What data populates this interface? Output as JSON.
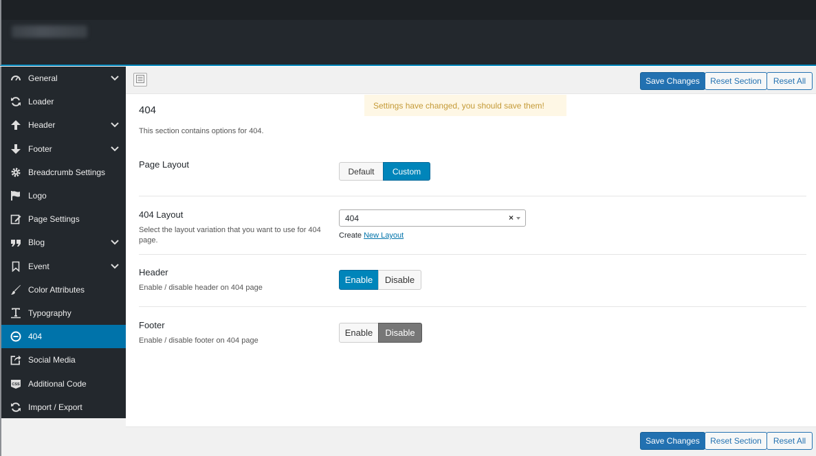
{
  "sidebar": {
    "items": [
      {
        "label": "General",
        "icon": "dashboard-gauge-icon",
        "expandable": true
      },
      {
        "label": "Loader",
        "icon": "refresh-icon",
        "expandable": false
      },
      {
        "label": "Header",
        "icon": "arrow-up-icon",
        "expandable": true
      },
      {
        "label": "Footer",
        "icon": "arrow-down-icon",
        "expandable": true
      },
      {
        "label": "Breadcrumb Settings",
        "icon": "gear-icon",
        "expandable": false
      },
      {
        "label": "Logo",
        "icon": "flag-icon",
        "expandable": false
      },
      {
        "label": "Page Settings",
        "icon": "edit-page-icon",
        "expandable": false
      },
      {
        "label": "Blog",
        "icon": "quote-icon",
        "expandable": true
      },
      {
        "label": "Event",
        "icon": "bookmark-icon",
        "expandable": true
      },
      {
        "label": "Color Attributes",
        "icon": "brush-icon",
        "expandable": false
      },
      {
        "label": "Typography",
        "icon": "text-icon",
        "expandable": false
      },
      {
        "label": "404",
        "icon": "minus-circle-icon",
        "expandable": false,
        "active": true
      },
      {
        "label": "Social Media",
        "icon": "share-icon",
        "expandable": false
      },
      {
        "label": "Additional Code",
        "icon": "css-icon",
        "expandable": false
      },
      {
        "label": "Import / Export",
        "icon": "refresh-icon",
        "expandable": false
      }
    ]
  },
  "toolbar": {
    "save_label": "Save Changes",
    "reset_section_label": "Reset Section",
    "reset_all_label": "Reset All"
  },
  "notice": "Settings have changed, you should save them!",
  "section": {
    "title": "404",
    "description": "This section contains options for 404."
  },
  "fields": {
    "page_layout": {
      "title": "Page Layout",
      "options": [
        "Default",
        "Custom"
      ],
      "selected": "Custom"
    },
    "layout_404": {
      "title": "404 Layout",
      "description": "Select the layout variation that you want to use for 404 page.",
      "value": "404",
      "clear": "×",
      "create_prefix": "Create",
      "create_link": "New Layout"
    },
    "header": {
      "title": "Header",
      "description": "Enable / disable header on 404 page",
      "options": [
        "Enable",
        "Disable"
      ],
      "selected": "Enable"
    },
    "footer": {
      "title": "Footer",
      "description": "Enable / disable footer on 404 page",
      "options": [
        "Enable",
        "Disable"
      ],
      "selected": "Disable"
    }
  },
  "colors": {
    "accent": "#0085ba",
    "sidebar_bg": "#23282d",
    "active_item": "#0073aa",
    "primary_button": "#2271b1",
    "notice_bg": "#fef7e5",
    "notice_text": "#c49a37"
  }
}
